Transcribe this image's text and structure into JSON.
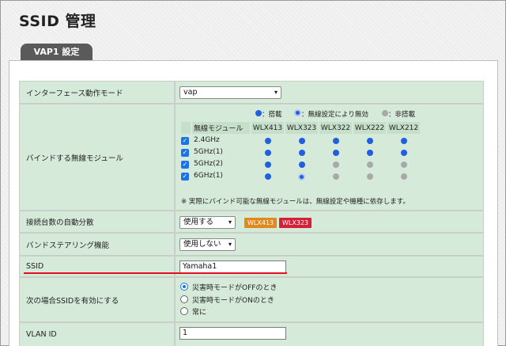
{
  "page": {
    "title": "SSID 管理"
  },
  "tab": {
    "label": "VAP1 設定"
  },
  "rows": {
    "interface_mode": {
      "label": "インターフェース動作モード",
      "value": "vap"
    },
    "bind_module": {
      "label": "バインドする無線モジュール",
      "legend": {
        "on": "：搭載",
        "disabled": "：無線設定により無効",
        "off": "：非搭載"
      },
      "header_module": "無線モジュール",
      "models": [
        "WLX413",
        "WLX323",
        "WLX322",
        "WLX222",
        "WLX212"
      ],
      "bands": [
        {
          "name": "2.4GHz",
          "checked": true,
          "states": [
            "on",
            "on",
            "on",
            "on",
            "on"
          ]
        },
        {
          "name": "5GHz(1)",
          "checked": true,
          "states": [
            "on",
            "on",
            "on",
            "on",
            "on"
          ]
        },
        {
          "name": "5GHz(2)",
          "checked": true,
          "states": [
            "on",
            "on",
            "off",
            "off",
            "off"
          ]
        },
        {
          "name": "6GHz(1)",
          "checked": true,
          "states": [
            "on",
            "disabled",
            "off",
            "off",
            "off"
          ]
        }
      ],
      "note": "※ 実際にバインド可能な無線モジュールは、無線設定や機種に依存します。"
    },
    "auto_distribution": {
      "label": "接続台数の自動分散",
      "value": "使用する",
      "badges": [
        {
          "text": "WLX413",
          "color": "#e08a1e"
        },
        {
          "text": "WLX323",
          "color": "#d42038"
        }
      ]
    },
    "band_steering": {
      "label": "バンドステアリング機能",
      "value": "使用しない"
    },
    "ssid": {
      "label": "SSID",
      "value": "Yamaha1"
    },
    "ssid_enable": {
      "label": "次の場合SSIDを有効にする",
      "options": [
        "災害時モードがOFFのとき",
        "災害時モードがONのとき",
        "常に"
      ],
      "selected": 0
    },
    "vlan": {
      "label": "VLAN ID",
      "value": "1"
    }
  },
  "colors": {
    "module_on": "#1f5fe0",
    "module_off": "#a9a9a9",
    "accent_line": "#e0101e",
    "tab_bg": "#5a5a5a",
    "row_bg": "#d6ead9"
  }
}
